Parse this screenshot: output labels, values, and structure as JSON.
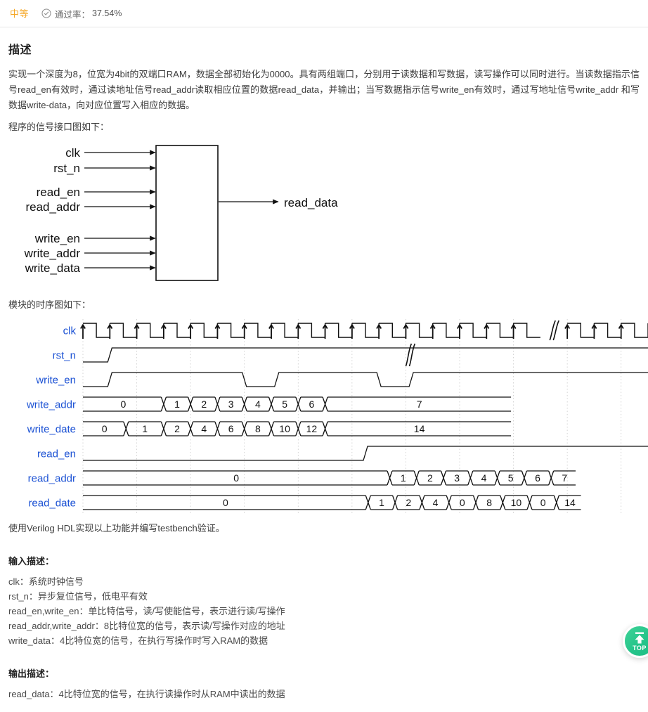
{
  "meta": {
    "difficulty": "中等",
    "check_icon": "check-circle-icon",
    "pass_rate_label": "通过率：",
    "pass_rate_value": "37.54%"
  },
  "description": {
    "title": "描述",
    "paragraph": "实现一个深度为8，位宽为4bit的双端口RAM，数据全部初始化为0000。具有两组端口，分别用于读数据和写数据，读写操作可以同时进行。当读数据指示信号read_en有效时，通过读地址信号read_addr读取相应位置的数据read_data，并输出；当写数据指示信号write_en有效时，通过写地址信号write_addr 和写数据write-data，向对应位置写入相应的数据。",
    "interface_caption": "程序的信号接口图如下：",
    "timing_caption": "模块的时序图如下：",
    "closing": "使用Verilog HDL实现以上功能并编写testbench验证。"
  },
  "block_diagram": {
    "inputs": [
      "clk",
      "rst_n",
      "read_en",
      "read_addr",
      "write_en",
      "write_addr",
      "write_data"
    ],
    "outputs": [
      "read_data"
    ]
  },
  "chart_data": {
    "type": "timing",
    "title": "模块的时序图",
    "signal_label_color": "#1c52d4",
    "signals": [
      {
        "name": "clk",
        "kind": "clock",
        "cycles": 21,
        "break_after_cycle": 17,
        "rising_edge_arrows": true
      },
      {
        "name": "rst_n",
        "kind": "level",
        "transitions": [
          {
            "cycle": 0,
            "value": 0
          },
          {
            "cycle": 1,
            "value": 1
          }
        ],
        "break_after_cycle": 12
      },
      {
        "name": "write_en",
        "kind": "level",
        "transitions": [
          {
            "cycle": 0,
            "value": 0
          },
          {
            "cycle": 1,
            "value": 1
          },
          {
            "cycle": 6,
            "value": 0
          },
          {
            "cycle": 7.2,
            "value": 1
          },
          {
            "cycle": 11,
            "value": 0
          },
          {
            "cycle": 12.2,
            "value": 1
          }
        ]
      },
      {
        "name": "write_addr",
        "kind": "bus",
        "values": [
          "0",
          "1",
          "2",
          "3",
          "4",
          "5",
          "6",
          "7"
        ],
        "spans": [
          3,
          1,
          1,
          1,
          1,
          1,
          1,
          7
        ],
        "ends_early": true
      },
      {
        "name": "write_date",
        "kind": "bus",
        "values": [
          "0",
          "1",
          "2",
          "4",
          "6",
          "8",
          "10",
          "12",
          "14"
        ],
        "spans": [
          1.6,
          1.4,
          1,
          1,
          1,
          1,
          1,
          1,
          7
        ],
        "ends_early": true
      },
      {
        "name": "read_en",
        "kind": "level",
        "transitions": [
          {
            "cycle": 0,
            "value": 0
          },
          {
            "cycle": 10.5,
            "value": 1
          }
        ]
      },
      {
        "name": "read_addr",
        "kind": "bus",
        "values": [
          "0",
          "1",
          "2",
          "3",
          "4",
          "5",
          "6",
          "7"
        ],
        "spans": [
          11.4,
          1,
          1,
          1,
          1,
          1,
          1,
          1
        ]
      },
      {
        "name": "read_date",
        "kind": "bus",
        "values": [
          "0",
          "1",
          "2",
          "4",
          "0",
          "8",
          "10",
          "0",
          "14"
        ],
        "spans": [
          10.6,
          1,
          1,
          1,
          1,
          1,
          1,
          1,
          1
        ]
      }
    ]
  },
  "input_description": {
    "heading": "输入描述：",
    "lines": [
      "clk：系统时钟信号",
      "rst_n：异步复位信号，低电平有效",
      "read_en,write_en：单比特信号，读/写使能信号，表示进行读/写操作",
      "read_addr,write_addr：8比特位宽的信号，表示读/写操作对应的地址",
      "write_data：4比特位宽的信号，在执行写操作时写入RAM的数据"
    ]
  },
  "output_description": {
    "heading": "输出描述：",
    "lines": [
      "read_data：4比特位宽的信号，在执行读操作时从RAM中读出的数据"
    ]
  },
  "back_to_top": {
    "icon": "arrow-up-icon",
    "label": "TOP"
  }
}
